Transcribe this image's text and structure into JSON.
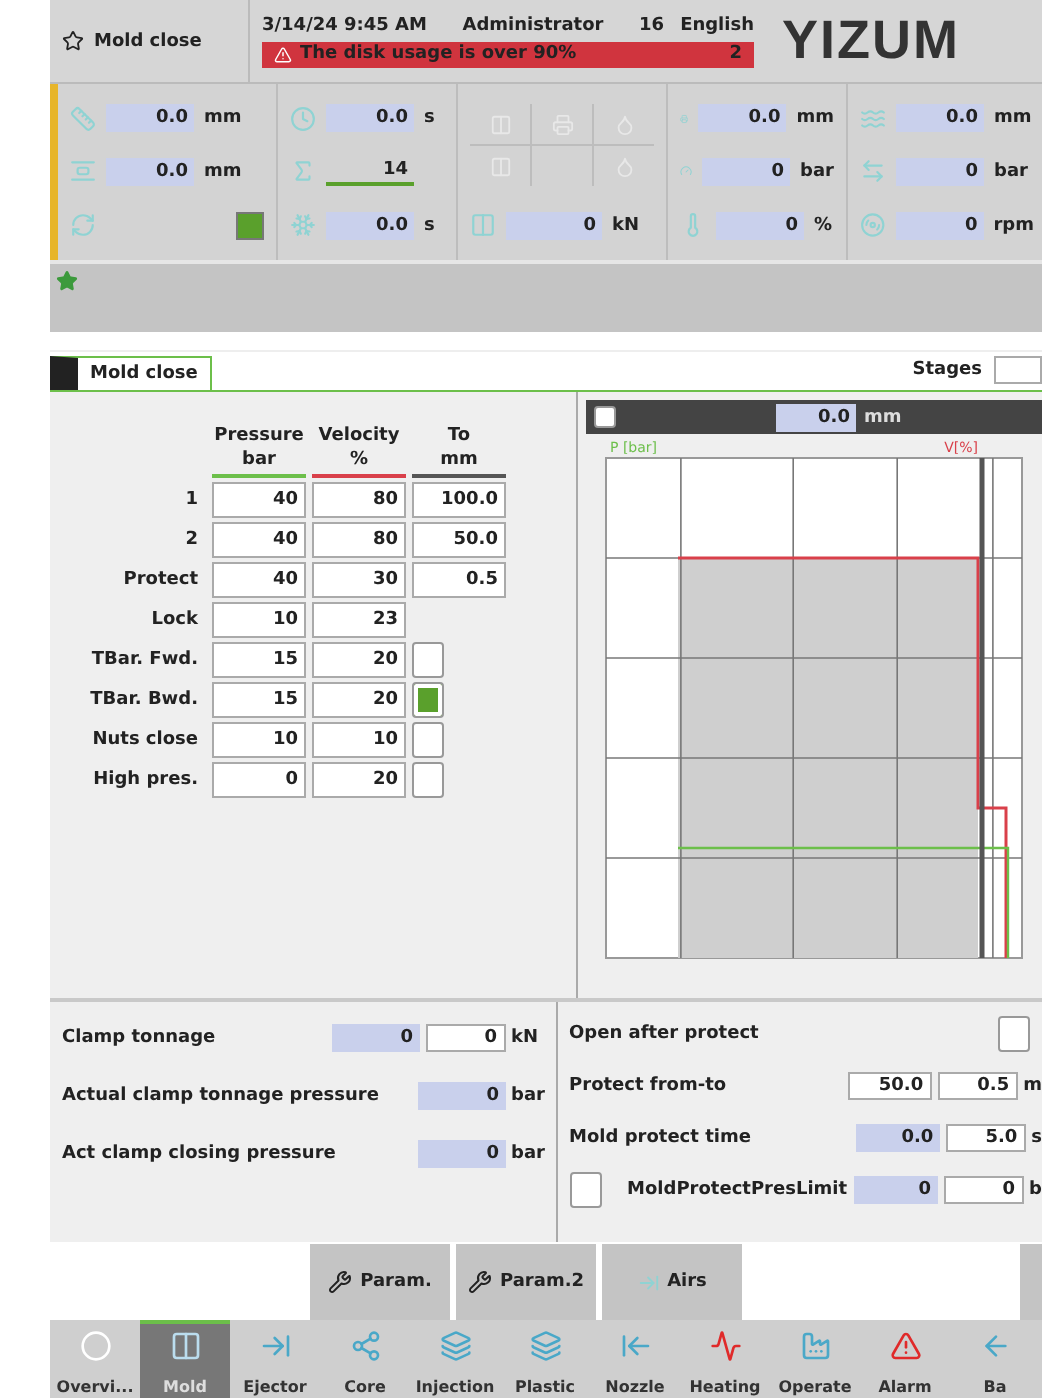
{
  "header": {
    "title": "Mold close",
    "datetime": "3/14/24 9:45 AM",
    "user": "Administrator",
    "number": "16",
    "language": "English",
    "alarm": {
      "message": "The disk usage is over 90%",
      "count": "2"
    },
    "logo": "YIZUM"
  },
  "status": {
    "columns": [
      {
        "rows": [
          {
            "kind": "value",
            "value": "0.0",
            "unit": "mm"
          },
          {
            "kind": "value",
            "value": "0.0",
            "unit": "mm"
          },
          {
            "kind": "indicator",
            "on": true
          }
        ]
      },
      {
        "rows": [
          {
            "kind": "value",
            "value": "0.0",
            "unit": "s"
          },
          {
            "kind": "counter",
            "value": "14"
          },
          {
            "kind": "value",
            "value": "0.0",
            "unit": "s"
          }
        ]
      },
      {
        "rows": [
          {
            "kind": "grid"
          },
          {
            "kind": "force",
            "value": "0",
            "unit": "kN"
          }
        ]
      },
      {
        "rows": [
          {
            "kind": "value",
            "value": "0.0",
            "unit": "mm"
          },
          {
            "kind": "value",
            "value": "0",
            "unit": "bar"
          },
          {
            "kind": "value",
            "value": "0",
            "unit": "%"
          }
        ]
      },
      {
        "rows": [
          {
            "kind": "value",
            "value": "0.0",
            "unit": "mm"
          },
          {
            "kind": "value",
            "value": "0",
            "unit": "bar"
          },
          {
            "kind": "value",
            "value": "0",
            "unit": "rpm"
          }
        ]
      }
    ]
  },
  "main": {
    "tab": "Mold close",
    "stages_label": "Stages",
    "table": {
      "columns": [
        {
          "title": "Pressure",
          "unit": "bar",
          "color": "#6cbf4a"
        },
        {
          "title": "Velocity",
          "unit": "%",
          "color": "#d9404a"
        },
        {
          "title": "To",
          "unit": "mm",
          "color": "#555555"
        }
      ],
      "rows": [
        {
          "kind": "position",
          "label": "1",
          "pressure": "40",
          "velocity": "80",
          "to": "100.0"
        },
        {
          "kind": "position",
          "label": "2",
          "pressure": "40",
          "velocity": "80",
          "to": "50.0"
        },
        {
          "kind": "position",
          "label": "Protect",
          "pressure": "40",
          "velocity": "30",
          "to": "0.5"
        },
        {
          "kind": "plain",
          "label": "Lock",
          "pressure": "10",
          "velocity": "23"
        },
        {
          "kind": "check",
          "label": "TBar. Fwd.",
          "pressure": "15",
          "velocity": "20",
          "checked": false
        },
        {
          "kind": "check",
          "label": "TBar. Bwd.",
          "pressure": "15",
          "velocity": "20",
          "checked": true
        },
        {
          "kind": "check",
          "label": "Nuts close",
          "pressure": "10",
          "velocity": "10",
          "checked": false
        },
        {
          "kind": "check",
          "label": "High pres.",
          "pressure": "0",
          "velocity": "20",
          "checked": false
        }
      ]
    },
    "chart": {
      "checked": false,
      "value": "0.0",
      "unit": "mm",
      "left_axis": "P [bar]",
      "right_axis": "V[%]"
    },
    "left_params": [
      {
        "label": "Clamp tonnage",
        "actual": "0",
        "value": "0",
        "unit": "kN"
      },
      {
        "label": "Actual clamp tonnage pressure",
        "actual": "0",
        "unit": "bar"
      },
      {
        "label": "Act clamp closing pressure",
        "actual": "0",
        "unit": "bar"
      }
    ],
    "right_params": [
      {
        "kind": "check",
        "label": "Open after protect",
        "checked": false
      },
      {
        "kind": "range",
        "label": "Protect from-to",
        "from": "50.0",
        "to": "0.5",
        "unit": "m"
      },
      {
        "kind": "actual",
        "label": "Mold protect time",
        "actual": "0.0",
        "value": "5.0",
        "unit": "s"
      },
      {
        "kind": "limit",
        "label": "MoldProtectPresLimit",
        "checked": false,
        "actual": "0",
        "value": "0",
        "unit": "b"
      }
    ]
  },
  "subnav": [
    "Param.",
    "Param.2",
    "Airs"
  ],
  "nav": [
    {
      "label": "Overvi...",
      "selected": false
    },
    {
      "label": "Mold",
      "selected": true
    },
    {
      "label": "Ejector",
      "selected": false
    },
    {
      "label": "Core",
      "selected": false
    },
    {
      "label": "Injection",
      "selected": false
    },
    {
      "label": "Plastic",
      "selected": false
    },
    {
      "label": "Nozzle",
      "selected": false
    },
    {
      "label": "Heating",
      "selected": false
    },
    {
      "label": "Operate",
      "selected": false
    },
    {
      "label": "Alarm",
      "selected": false
    },
    {
      "label": "Ba",
      "selected": false
    }
  ]
}
